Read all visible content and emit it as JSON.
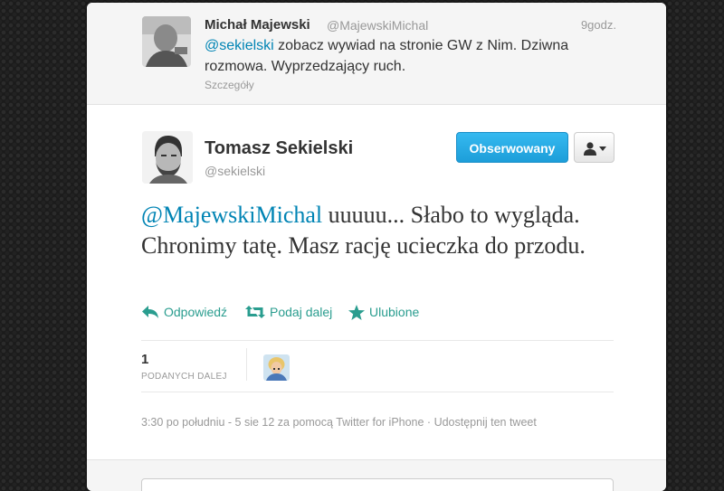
{
  "reply_tweet": {
    "author_name": "Michał Majewski",
    "author_handle": "@MajewskiMichal",
    "time": "9godz.",
    "mention": "@sekielski",
    "text": " zobacz wywiad na stronie GW z Nim. Dziwna rozmowa. Wyprzedzający ruch.",
    "details_link": "Szczegóły"
  },
  "main_tweet": {
    "author_name": "Tomasz Sekielski",
    "author_handle": "@sekielski",
    "follow_button": "Obserwowany",
    "mention": "@MajewskiMichal",
    "text": " uuuuu... Słabo to wygląda. Chronimy tatę. Masz rację ucieczka do przodu.",
    "actions": {
      "reply": "Odpowiedź",
      "retweet": "Podaj dalej",
      "favorite": "Ulubione"
    },
    "stats": {
      "retweet_count": "1",
      "retweet_label": "PODANYCH DALEJ"
    },
    "meta": "3:30 po południu - 5 sie 12 za pomocą Twitter for iPhone · Udostępnij ten tweet"
  },
  "colors": {
    "link": "#0084b4",
    "action": "#2a9d8f",
    "follow_button": "#1d9ed9"
  },
  "icons": [
    "reply-icon",
    "retweet-icon",
    "star-icon",
    "user-icon",
    "caret-down-icon"
  ]
}
